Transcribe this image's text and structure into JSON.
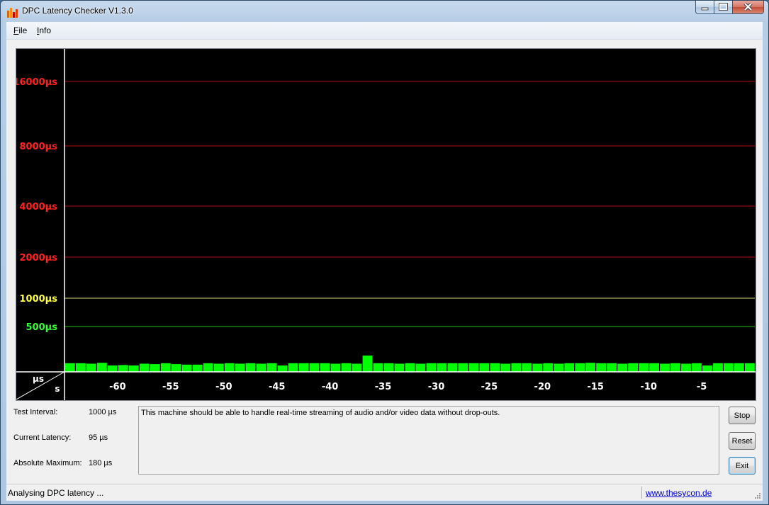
{
  "window": {
    "title": "DPC Latency Checker V1.3.0",
    "colors": {
      "frame": "#aec6e0",
      "client": "#f0f0f0"
    }
  },
  "menu": {
    "file_prefix": "F",
    "file_rest": "ile",
    "info_prefix": "I",
    "info_rest": "nfo"
  },
  "chart_data": {
    "type": "bar",
    "background": "#000000",
    "bar_color": "#00ff00",
    "y_axis_corner_label": "µs",
    "x_axis_corner_label": "s",
    "y_gridlines": [
      {
        "label": "16000µs",
        "color": "#ff2020",
        "line_color": "#b01010"
      },
      {
        "label": "8000µs",
        "color": "#ff2020",
        "line_color": "#b01010"
      },
      {
        "label": "4000µs",
        "color": "#ff2020",
        "line_color": "#b01010"
      },
      {
        "label": "2000µs",
        "color": "#ff2020",
        "line_color": "#b01010"
      },
      {
        "label": "1000µs",
        "color": "#ffff40",
        "line_color": "#d8d870"
      },
      {
        "label": "500µs",
        "color": "#30ff30",
        "line_color": "#20c020"
      }
    ],
    "x_ticks": [
      "-60",
      "-55",
      "-50",
      "-45",
      "-40",
      "-35",
      "-30",
      "-25",
      "-20",
      "-15",
      "-10",
      "-5"
    ],
    "x_range": [
      -65,
      0
    ],
    "values": [
      95,
      95,
      90,
      100,
      70,
      75,
      70,
      90,
      85,
      95,
      85,
      80,
      80,
      95,
      90,
      95,
      90,
      95,
      90,
      95,
      70,
      95,
      95,
      95,
      95,
      90,
      95,
      90,
      180,
      95,
      95,
      90,
      95,
      90,
      95,
      95,
      95,
      95,
      95,
      95,
      95,
      90,
      95,
      95,
      90,
      95,
      90,
      95,
      95,
      100,
      95,
      95,
      90,
      95,
      95,
      95,
      90,
      95,
      90,
      95,
      70,
      95,
      95,
      95,
      95
    ]
  },
  "stats": {
    "interval_label": "Test Interval:",
    "interval_value": "1000 µs",
    "current_label": "Current Latency:",
    "current_value": "95 µs",
    "max_label": "Absolute Maximum:",
    "max_value": "180 µs"
  },
  "message": "This machine should be able to handle real-time streaming of audio and/or video data without drop-outs.",
  "buttons": {
    "stop": "Stop",
    "reset": "Reset",
    "exit": "Exit"
  },
  "status": {
    "text": "Analysing DPC latency ...",
    "link": "www.thesycon.de"
  }
}
